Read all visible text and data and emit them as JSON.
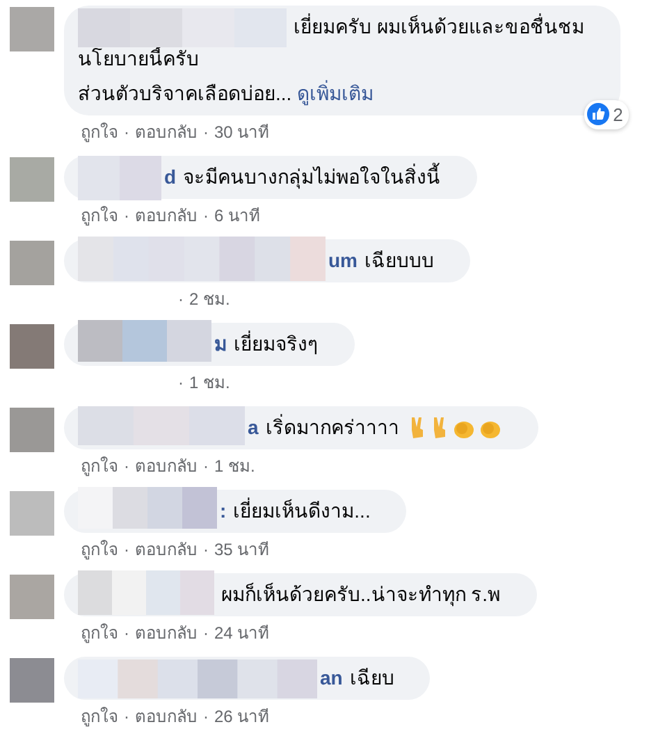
{
  "separator": "·",
  "comments": [
    {
      "paragraphs": [
        [
          "เยี่ยมครับ ผมเห็นด้วยและขอชื่นชม",
          "นโยบายนี้ครับ"
        ],
        [
          "ส่วนตัวบริจาคเลือดบ่อย..."
        ]
      ],
      "see_more": "ดูเพิ่มเติม",
      "reactions": {
        "count": "2"
      },
      "like": "ถูกใจ",
      "reply": "ตอบกลับ",
      "time": "30 นาที"
    },
    {
      "name_fragment": "d",
      "paragraphs": [
        [
          "จะมีคนบางกลุ่มไม่พอใจในสิ่งนี้"
        ]
      ],
      "like": "ถูกใจ",
      "reply": "ตอบกลับ",
      "time": "6 นาที"
    },
    {
      "name_fragment": "um",
      "paragraphs": [
        [
          "เฉียบบบ"
        ]
      ],
      "time": "2 ชม."
    },
    {
      "name_fragment": "ม",
      "paragraphs": [
        [
          "เยี่ยมจริงๆ"
        ]
      ],
      "time": "1 ชม."
    },
    {
      "name_fragment": "a",
      "paragraphs": [
        [
          "เริ่ดมากคร่าาาา"
        ]
      ],
      "emojis": [
        {
          "kind": "victory"
        },
        {
          "kind": "victory"
        },
        {
          "kind": "clap"
        },
        {
          "kind": "clap"
        }
      ],
      "like": "ถูกใจ",
      "reply": "ตอบกลับ",
      "time": "1 ชม."
    },
    {
      "name_fragment": ":",
      "paragraphs": [
        [
          "เยี่ยมเห็นดีงาม..."
        ]
      ],
      "like": "ถูกใจ",
      "reply": "ตอบกลับ",
      "time": "35 นาที"
    },
    {
      "paragraphs": [
        [
          "ผมก็เห็นด้วยครับ..น่าจะทำทุก ร.พ"
        ]
      ],
      "like": "ถูกใจ",
      "reply": "ตอบกลับ",
      "time": "24 นาที"
    },
    {
      "name_fragment": "an",
      "paragraphs": [
        [
          "เฉียบ"
        ]
      ],
      "like": "ถูกใจ",
      "reply": "ตอบกลับ",
      "time": "26 นาที"
    }
  ]
}
